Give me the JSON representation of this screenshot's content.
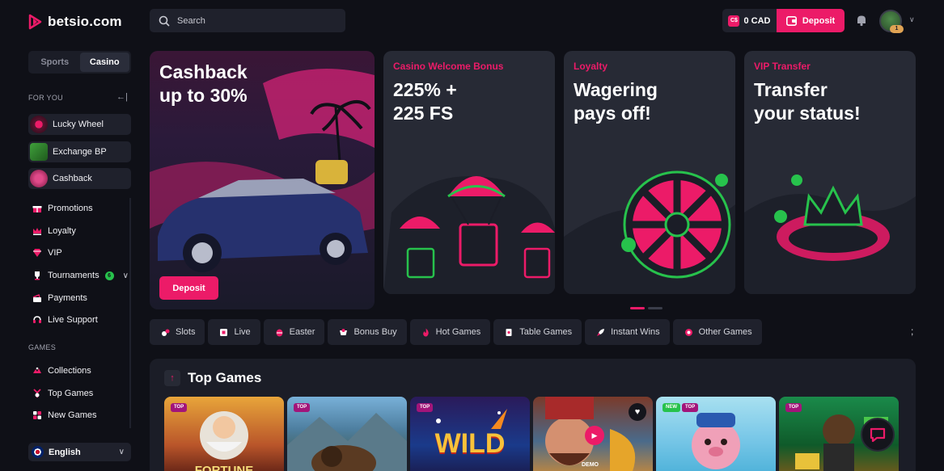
{
  "brand": {
    "name": "betsio.com",
    "accent": "#ec1b68"
  },
  "sidebar": {
    "mode_tabs": [
      {
        "label": "Sports",
        "active": false
      },
      {
        "label": "Casino",
        "active": true
      }
    ],
    "for_you_label": "FOR YOU",
    "features": [
      {
        "label": "Lucky Wheel",
        "icon": "wheel-icon"
      },
      {
        "label": "Exchange BP",
        "icon": "exchange-icon"
      },
      {
        "label": "Cashback",
        "icon": "cashback-icon"
      }
    ],
    "nav": [
      {
        "label": "Promotions",
        "icon": "gift-icon"
      },
      {
        "label": "Loyalty",
        "icon": "crown-icon"
      },
      {
        "label": "VIP",
        "icon": "diamond-icon"
      },
      {
        "label": "Tournaments",
        "icon": "trophy-icon",
        "badge": "6"
      },
      {
        "label": "Payments",
        "icon": "wallet-icon"
      },
      {
        "label": "Live Support",
        "icon": "headset-icon"
      }
    ],
    "games_label": "GAMES",
    "games_nav": [
      {
        "label": "Collections",
        "icon": "collections-icon"
      },
      {
        "label": "Top Games",
        "icon": "star-icon"
      },
      {
        "label": "New Games",
        "icon": "new-icon"
      }
    ],
    "language": "English"
  },
  "header": {
    "search_placeholder": "Search",
    "currency_symbol": "C$",
    "balance": "0 CAD",
    "deposit_label": "Deposit",
    "avatar_level": "1"
  },
  "banners": [
    {
      "title": "",
      "headline": [
        "Cashback",
        "up to 30%"
      ],
      "cta": "Deposit"
    },
    {
      "title": "Casino Welcome Bonus",
      "headline": [
        "225% +",
        "225 FS"
      ]
    },
    {
      "title": "Loyalty",
      "headline": [
        "Wagering",
        "pays off!"
      ]
    },
    {
      "title": "VIP Transfer",
      "headline": [
        "Transfer",
        "your status!"
      ]
    }
  ],
  "categories": [
    {
      "label": "Slots",
      "icon": "slots-icon"
    },
    {
      "label": "Live",
      "icon": "live-icon"
    },
    {
      "label": "Easter",
      "icon": "easter-icon"
    },
    {
      "label": "Bonus Buy",
      "icon": "bonus-buy-icon"
    },
    {
      "label": "Hot Games",
      "icon": "fire-icon"
    },
    {
      "label": "Table Games",
      "icon": "cards-icon"
    },
    {
      "label": "Instant Wins",
      "icon": "rocket-icon"
    },
    {
      "label": "Other Games",
      "icon": "chip-icon"
    }
  ],
  "more_symbol": ";",
  "top_games": {
    "title": "Top Games",
    "tiles": [
      {
        "tags": [
          "TOP"
        ],
        "name": "FORTUNE"
      },
      {
        "tags": [
          "TOP"
        ],
        "name": ""
      },
      {
        "tags": [
          "TOP"
        ],
        "name": "WILD"
      },
      {
        "tags": [],
        "name": "",
        "demo": "DEMO"
      },
      {
        "tags": [
          "NEW",
          "TOP"
        ],
        "name": ""
      },
      {
        "tags": [
          "TOP"
        ],
        "name": ""
      }
    ]
  }
}
